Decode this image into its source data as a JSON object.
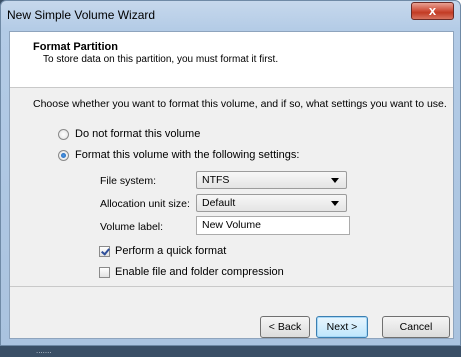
{
  "window": {
    "title": "New Simple Volume Wizard",
    "close_glyph": "x"
  },
  "header": {
    "title": "Format Partition",
    "subtitle": "To store data on this partition, you must format it first."
  },
  "instruction": "Choose whether you want to format this volume, and if so, what settings you want to use.",
  "options": {
    "no_format": {
      "label": "Do not format this volume",
      "selected": false
    },
    "format": {
      "label": "Format this volume with the following settings:",
      "selected": true
    }
  },
  "settings": {
    "file_system": {
      "label": "File system:",
      "value": "NTFS"
    },
    "allocation_unit": {
      "label": "Allocation unit size:",
      "value": "Default"
    },
    "volume_label": {
      "label": "Volume label:",
      "value": "New Volume"
    },
    "quick_format": {
      "label": "Perform a quick format",
      "checked": true
    },
    "compression": {
      "label": "Enable file and folder compression",
      "checked": false
    }
  },
  "buttons": {
    "back": "< Back",
    "next": "Next >",
    "cancel": "Cancel"
  },
  "background_text": "......."
}
